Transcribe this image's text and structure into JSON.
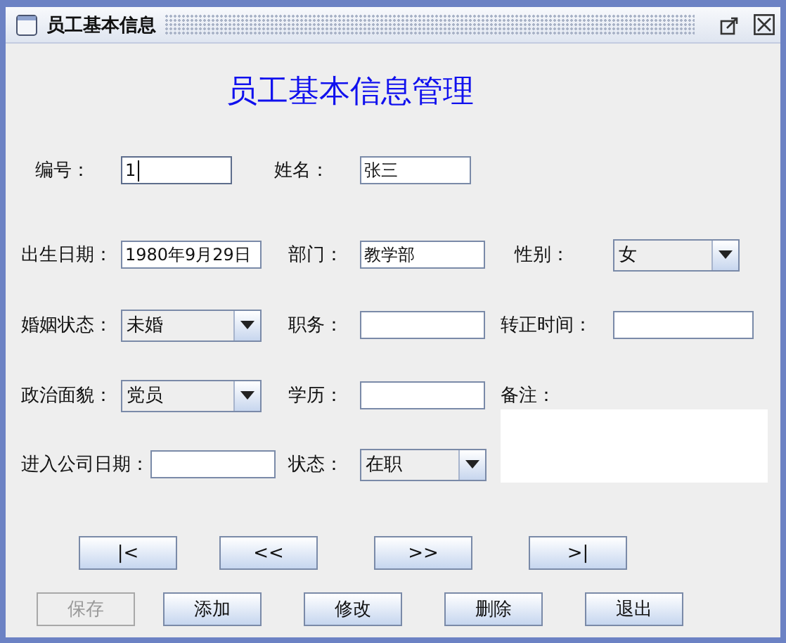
{
  "window": {
    "title": "员工基本信息"
  },
  "heading": "员工基本信息管理",
  "fields": [
    {
      "label": "编号：",
      "kind": "text",
      "value": "1",
      "focused": true
    },
    {
      "label": "姓名：",
      "kind": "text",
      "value": "张三",
      "focused": false
    },
    {
      "label": "出生日期：",
      "kind": "text",
      "value": "1980年9月29日",
      "focused": false
    },
    {
      "label": "部门：",
      "kind": "text",
      "value": "教学部",
      "focused": false
    },
    {
      "label": "性别：",
      "kind": "combo",
      "value": "女"
    },
    {
      "label": "婚姻状态：",
      "kind": "combo",
      "value": "未婚"
    },
    {
      "label": "职务：",
      "kind": "text",
      "focused": false
    },
    {
      "label": "转正时间：",
      "kind": "text",
      "focused": false
    },
    {
      "label": "政治面貌：",
      "kind": "combo",
      "value": "党员"
    },
    {
      "label": "学历：",
      "kind": "text",
      "focused": false
    },
    {
      "label": "备注：",
      "kind": "textarea"
    },
    {
      "label": "进入公司日期：",
      "kind": "text",
      "focused": false
    },
    {
      "label": "状态：",
      "kind": "combo",
      "value": "在职"
    }
  ],
  "nav_buttons": [
    "|<",
    "<<",
    ">>",
    ">|"
  ],
  "action_buttons": [
    {
      "label": "保存",
      "disabled": true
    },
    {
      "label": "添加",
      "disabled": false
    },
    {
      "label": "修改",
      "disabled": false
    },
    {
      "label": "删除",
      "disabled": false
    },
    {
      "label": "退出",
      "disabled": false
    }
  ]
}
